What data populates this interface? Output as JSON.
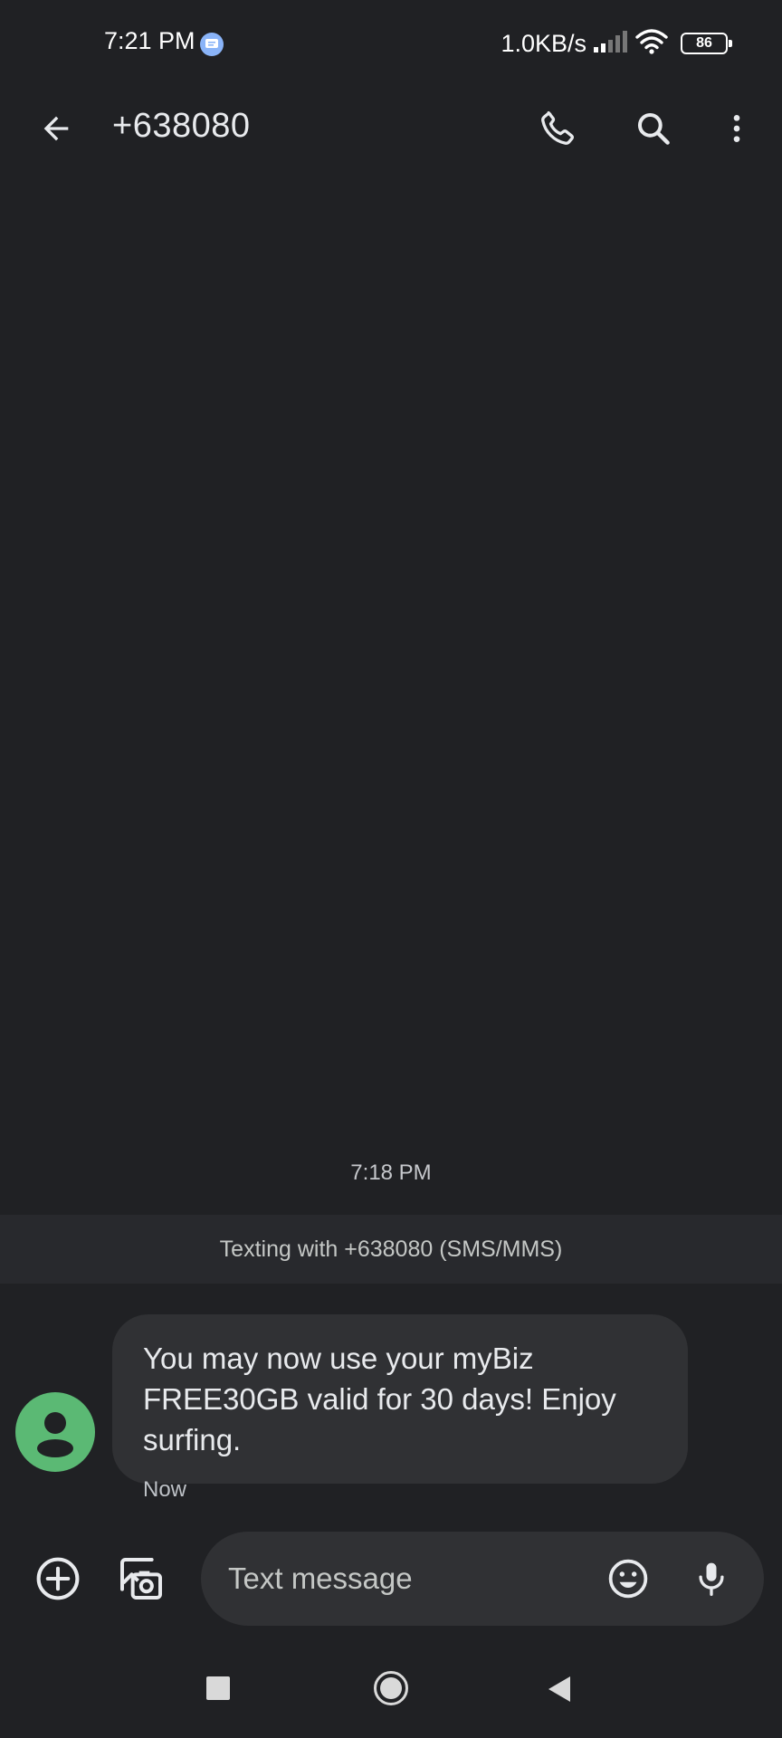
{
  "status_bar": {
    "time": "7:21 PM",
    "network_speed": "1.0KB/s",
    "battery_level": "86",
    "icons": [
      "messages-notification-icon",
      "signal-icon",
      "wifi-icon",
      "battery-icon"
    ]
  },
  "app_bar": {
    "title": "+638080",
    "icons": [
      "back-arrow-icon",
      "phone-icon",
      "search-icon",
      "more-vert-icon"
    ]
  },
  "thread": {
    "timestamp": "7:18 PM",
    "banner": "Texting with +638080 (SMS/MMS)",
    "messages": [
      {
        "text": "You may now use your myBiz FREE30GB valid for 30 days! Enjoy surfing.",
        "status": "Now",
        "sender_avatar": "person-avatar-icon"
      }
    ]
  },
  "compose": {
    "placeholder": "Text message",
    "value": "",
    "icons": [
      "add-circle-icon",
      "gallery-camera-icon",
      "emoji-icon",
      "mic-icon"
    ]
  },
  "nav_bar": {
    "icons": [
      "recents-square-icon",
      "home-circle-icon",
      "back-triangle-icon"
    ]
  },
  "colors": {
    "background": "#202124",
    "bubble": "#303134",
    "banner": "#28292d",
    "avatar": "#5bb974",
    "text_primary": "#e8eaed",
    "text_secondary": "#c4c7c5"
  }
}
